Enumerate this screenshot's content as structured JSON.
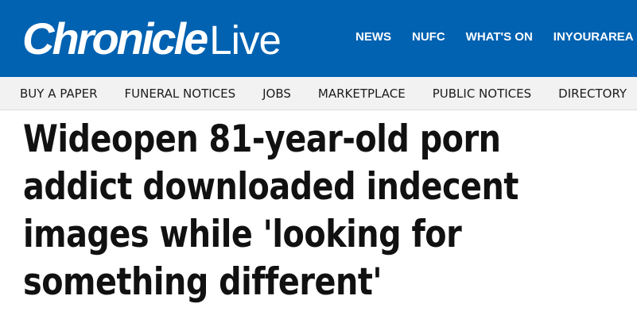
{
  "brand": {
    "logo_bold": "Chronicle",
    "logo_light": "Live"
  },
  "primary_nav": {
    "items": [
      {
        "label": "NEWS"
      },
      {
        "label": "NUFC"
      },
      {
        "label": "WHAT'S ON"
      },
      {
        "label": "INYOURAREA"
      }
    ]
  },
  "secondary_nav": {
    "items": [
      {
        "label": "BUY A PAPER"
      },
      {
        "label": "FUNERAL NOTICES"
      },
      {
        "label": "JOBS"
      },
      {
        "label": "MARKETPLACE"
      },
      {
        "label": "PUBLIC NOTICES"
      },
      {
        "label": "DIRECTORY"
      }
    ]
  },
  "article": {
    "headline": "Wideopen 81-year-old porn addict downloaded indecent images while 'looking for something different'"
  },
  "colors": {
    "brand_blue": "#0062b1",
    "subnav_bg": "#f2f2f2",
    "headline_text": "#111111"
  }
}
